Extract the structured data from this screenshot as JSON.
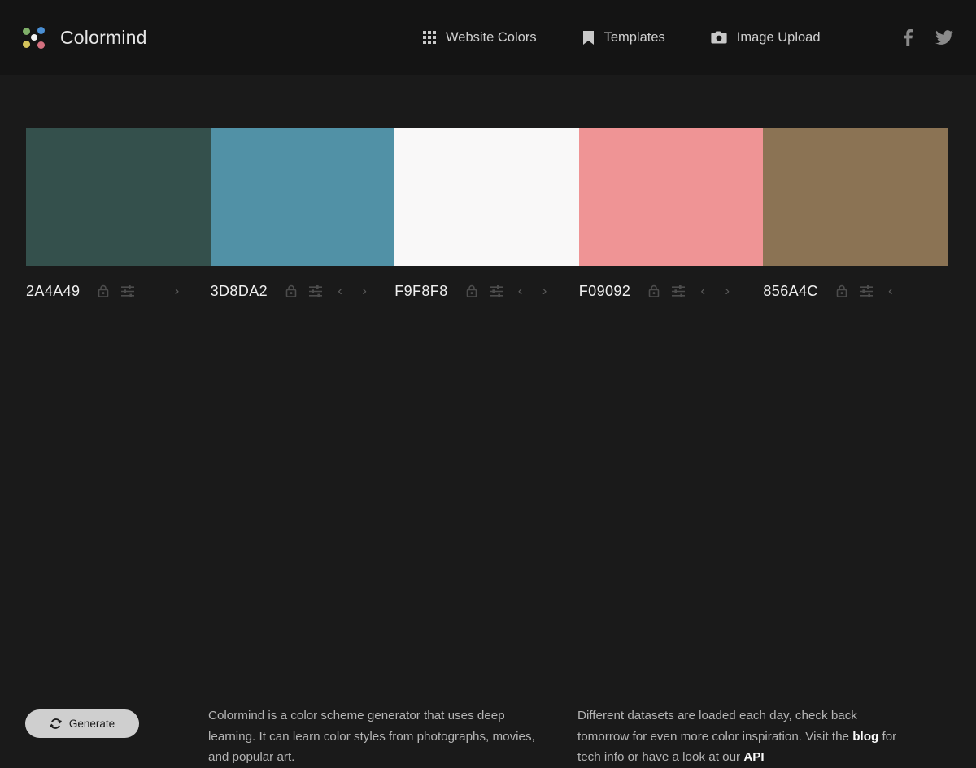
{
  "header": {
    "brand_name": "Colormind",
    "logo_icon": "colormind-dots-logo",
    "nav": [
      {
        "label": "Website Colors",
        "icon": "grid-icon",
        "name": "nav-website-colors"
      },
      {
        "label": "Templates",
        "icon": "bookmark-icon",
        "name": "nav-templates"
      },
      {
        "label": "Image Upload",
        "icon": "camera-icon",
        "name": "nav-image-upload"
      }
    ],
    "social": [
      {
        "icon": "facebook-icon",
        "name": "social-facebook"
      },
      {
        "icon": "twitter-icon",
        "name": "social-twitter"
      }
    ]
  },
  "palette": {
    "swatches": [
      {
        "hex": "2A4A49",
        "color": "#34504c",
        "lock_icon": "lock-icon",
        "sliders_icon": "sliders-icon",
        "has_prev": false,
        "has_next": true
      },
      {
        "hex": "3D8DA2",
        "color": "#5191a6",
        "lock_icon": "lock-icon",
        "sliders_icon": "sliders-icon",
        "has_prev": true,
        "has_next": true
      },
      {
        "hex": "F9F8F8",
        "color": "#f9f8f8",
        "lock_icon": "lock-icon",
        "sliders_icon": "sliders-icon",
        "has_prev": true,
        "has_next": true
      },
      {
        "hex": "F09092",
        "color": "#ef9495",
        "lock_icon": "lock-icon",
        "sliders_icon": "sliders-icon",
        "has_prev": true,
        "has_next": true
      },
      {
        "hex": "856A4C",
        "color": "#8b7354",
        "lock_icon": "lock-icon",
        "sliders_icon": "sliders-icon",
        "has_prev": true,
        "has_next": false
      }
    ]
  },
  "bottom": {
    "generate_label": "Generate",
    "generate_icon": "refresh-icon",
    "blurb_left": "Colormind is a color scheme generator that uses deep learning. It can learn color styles from photographs, movies, and popular art.",
    "blurb_right_part1": "Different datasets are loaded each day, check back tomorrow for even more color inspiration. Visit the ",
    "blurb_right_link1": "blog",
    "blurb_right_part2": " for tech info or have a look at our ",
    "blurb_right_link2": "API"
  },
  "colors": {
    "page_background": "#1a1a1a",
    "header_background": "#141414",
    "text_primary": "#e6e6e6",
    "text_secondary": "#b4b4b4",
    "button_background": "#cfcfcf"
  }
}
